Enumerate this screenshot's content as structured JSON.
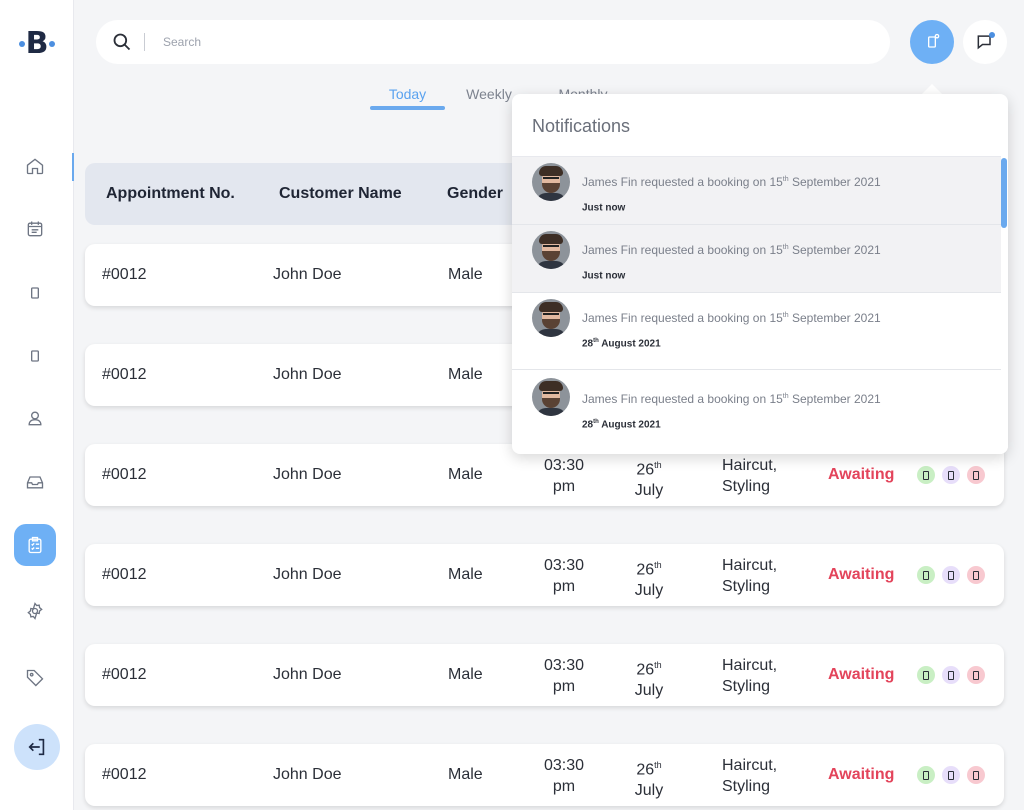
{
  "brand": {
    "logo_letter": "B"
  },
  "search": {
    "placeholder": "Search"
  },
  "tabs": [
    {
      "label": "Today",
      "active": true
    },
    {
      "label": "Weekly",
      "active": false
    },
    {
      "label": "Monthly",
      "active": false
    }
  ],
  "table": {
    "headers": [
      "Appointment No.",
      "Customer Name",
      "Gender"
    ],
    "rows": [
      {
        "appt": "#0012",
        "customer": "John Doe",
        "gender": "Male"
      },
      {
        "appt": "#0012",
        "customer": "John Doe",
        "gender": "Male"
      },
      {
        "appt": "#0012",
        "customer": "John Doe",
        "gender": "Male",
        "time_1": "03:30",
        "time_2": "pm",
        "day": "26",
        "day_suffix": "th",
        "month": "July",
        "service_1": "Haircut,",
        "service_2": "Styling",
        "status": "Awaiting"
      },
      {
        "appt": "#0012",
        "customer": "John Doe",
        "gender": "Male",
        "time_1": "03:30",
        "time_2": "pm",
        "day": "26",
        "day_suffix": "th",
        "month": "July",
        "service_1": "Haircut,",
        "service_2": "Styling",
        "status": "Awaiting"
      },
      {
        "appt": "#0012",
        "customer": "John Doe",
        "gender": "Male",
        "time_1": "03:30",
        "time_2": "pm",
        "day": "26",
        "day_suffix": "th",
        "month": "July",
        "service_1": "Haircut,",
        "service_2": "Styling",
        "status": "Awaiting"
      },
      {
        "appt": "#0012",
        "customer": "John Doe",
        "gender": "Male",
        "time_1": "03:30",
        "time_2": "pm",
        "day": "26",
        "day_suffix": "th",
        "month": "July",
        "service_1": "Haircut,",
        "service_2": "Styling",
        "status": "Awaiting"
      }
    ]
  },
  "notifications": {
    "title": "Notifications",
    "items": [
      {
        "text_before": "James Fin requested a booking on 15",
        "text_suffix": "th",
        "text_after": " September 2021",
        "time_main": "Just now",
        "time_suffix": "",
        "time_rest": "",
        "read": true
      },
      {
        "text_before": "James Fin requested a booking on 15",
        "text_suffix": "th",
        "text_after": " September 2021",
        "time_main": "Just now",
        "time_suffix": "",
        "time_rest": "",
        "read": true
      },
      {
        "text_before": "James Fin requested a booking on 15",
        "text_suffix": "th",
        "text_after": " September 2021",
        "time_main": "28",
        "time_suffix": "th",
        "time_rest": " August 2021",
        "read": false
      },
      {
        "text_before": "James Fin requested a booking on 15",
        "text_suffix": "th",
        "text_after": " September 2021",
        "time_main": "28",
        "time_suffix": "th",
        "time_rest": " August 2021",
        "read": false
      }
    ]
  },
  "colors": {
    "accent": "#6eb0f5",
    "status_awaiting": "#e3445b",
    "action_accept": "#c9efc4",
    "action_edit": "#e7defa",
    "action_delete": "#f8c9d0"
  },
  "icons": {
    "sidebar": [
      "home-icon",
      "calendar-icon",
      "phone-icon",
      "tablet-icon",
      "user-icon",
      "inbox-icon",
      "clipboard-icon",
      "settings-icon",
      "tag-icon"
    ],
    "logout": "logout-icon",
    "top": [
      "search-icon",
      "notification-icon",
      "chat-icon"
    ]
  }
}
